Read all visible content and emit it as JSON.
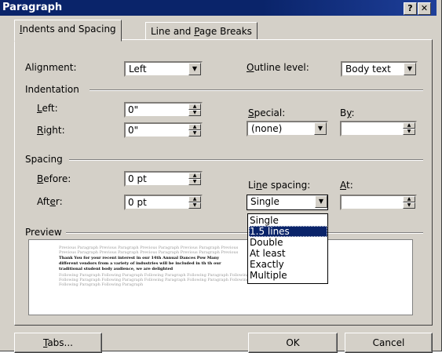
{
  "window": {
    "title": "Paragraph",
    "help_button": "?",
    "close_button": "✕"
  },
  "tabs": [
    {
      "label_pre": "",
      "label_ul": "I",
      "label_post": "ndents and Spacing",
      "active": true
    },
    {
      "label_pre": "Line and ",
      "label_ul": "P",
      "label_post": "age Breaks",
      "active": false
    }
  ],
  "general": {
    "alignment_label": "Alignment:",
    "alignment_value": "Left",
    "outline_label_ul": "O",
    "outline_label_post": "utline level:",
    "outline_value": "Body text"
  },
  "indentation": {
    "group_label": "Indentation",
    "left_label_ul": "L",
    "left_label_post": "eft:",
    "left_value": "0\"",
    "right_label_ul": "R",
    "right_label_post": "ight:",
    "right_value": "0\"",
    "special_label_ul": "S",
    "special_label_post": "pecial:",
    "special_value": "(none)",
    "by_label_pre": "B",
    "by_label_ul": "y",
    "by_label_post": ":",
    "by_value": ""
  },
  "spacing": {
    "group_label": "Spacing",
    "before_label_ul": "B",
    "before_label_post": "efore:",
    "before_value": "0 pt",
    "after_label_pre": "Aft",
    "after_label_ul": "e",
    "after_label_post": "r:",
    "after_value": "0 pt",
    "line_spacing_label_pre": "Li",
    "line_spacing_label_ul": "n",
    "line_spacing_label_post": "e spacing:",
    "line_spacing_value": "Single",
    "at_label_ul": "A",
    "at_label_post": "t:",
    "at_value": ""
  },
  "line_spacing_options": [
    "Single",
    "1.5 lines",
    "Double",
    "At least",
    "Exactly",
    "Multiple"
  ],
  "line_spacing_highlighted": "1.5 lines",
  "preview": {
    "group_label": "Preview",
    "lines": [
      {
        "style": "gray",
        "text": "Previous Paragraph Previous Paragraph Previous Paragraph Previous Paragraph Previous"
      },
      {
        "style": "gray",
        "text": "Previous Paragraph Previous Paragraph Previous Paragraph Previous Paragraph Previous"
      },
      {
        "style": "bold",
        "text": "Thank You for your recent interest in our 14th Annual Dances Pow                                                              Many"
      },
      {
        "style": "bold",
        "text": "different vendors from a variety of industries will be included in th                                                   th our"
      },
      {
        "style": "bold",
        "text": "traditional student body audience, we are delighted"
      },
      {
        "style": "gray",
        "text": "Following Paragraph Following Paragraph Following Paragraph Following Paragraph Following Paragraph Following Paragraph"
      },
      {
        "style": "gray",
        "text": "Following Paragraph Following Paragraph Following Paragraph Following Paragraph Following Paragraph Following Paragraph"
      },
      {
        "style": "gray",
        "text": "Following Paragraph Following Paragraph"
      }
    ]
  },
  "buttons": {
    "tabs_ul": "T",
    "tabs_post": "abs...",
    "ok": "OK",
    "cancel": "Cancel"
  }
}
